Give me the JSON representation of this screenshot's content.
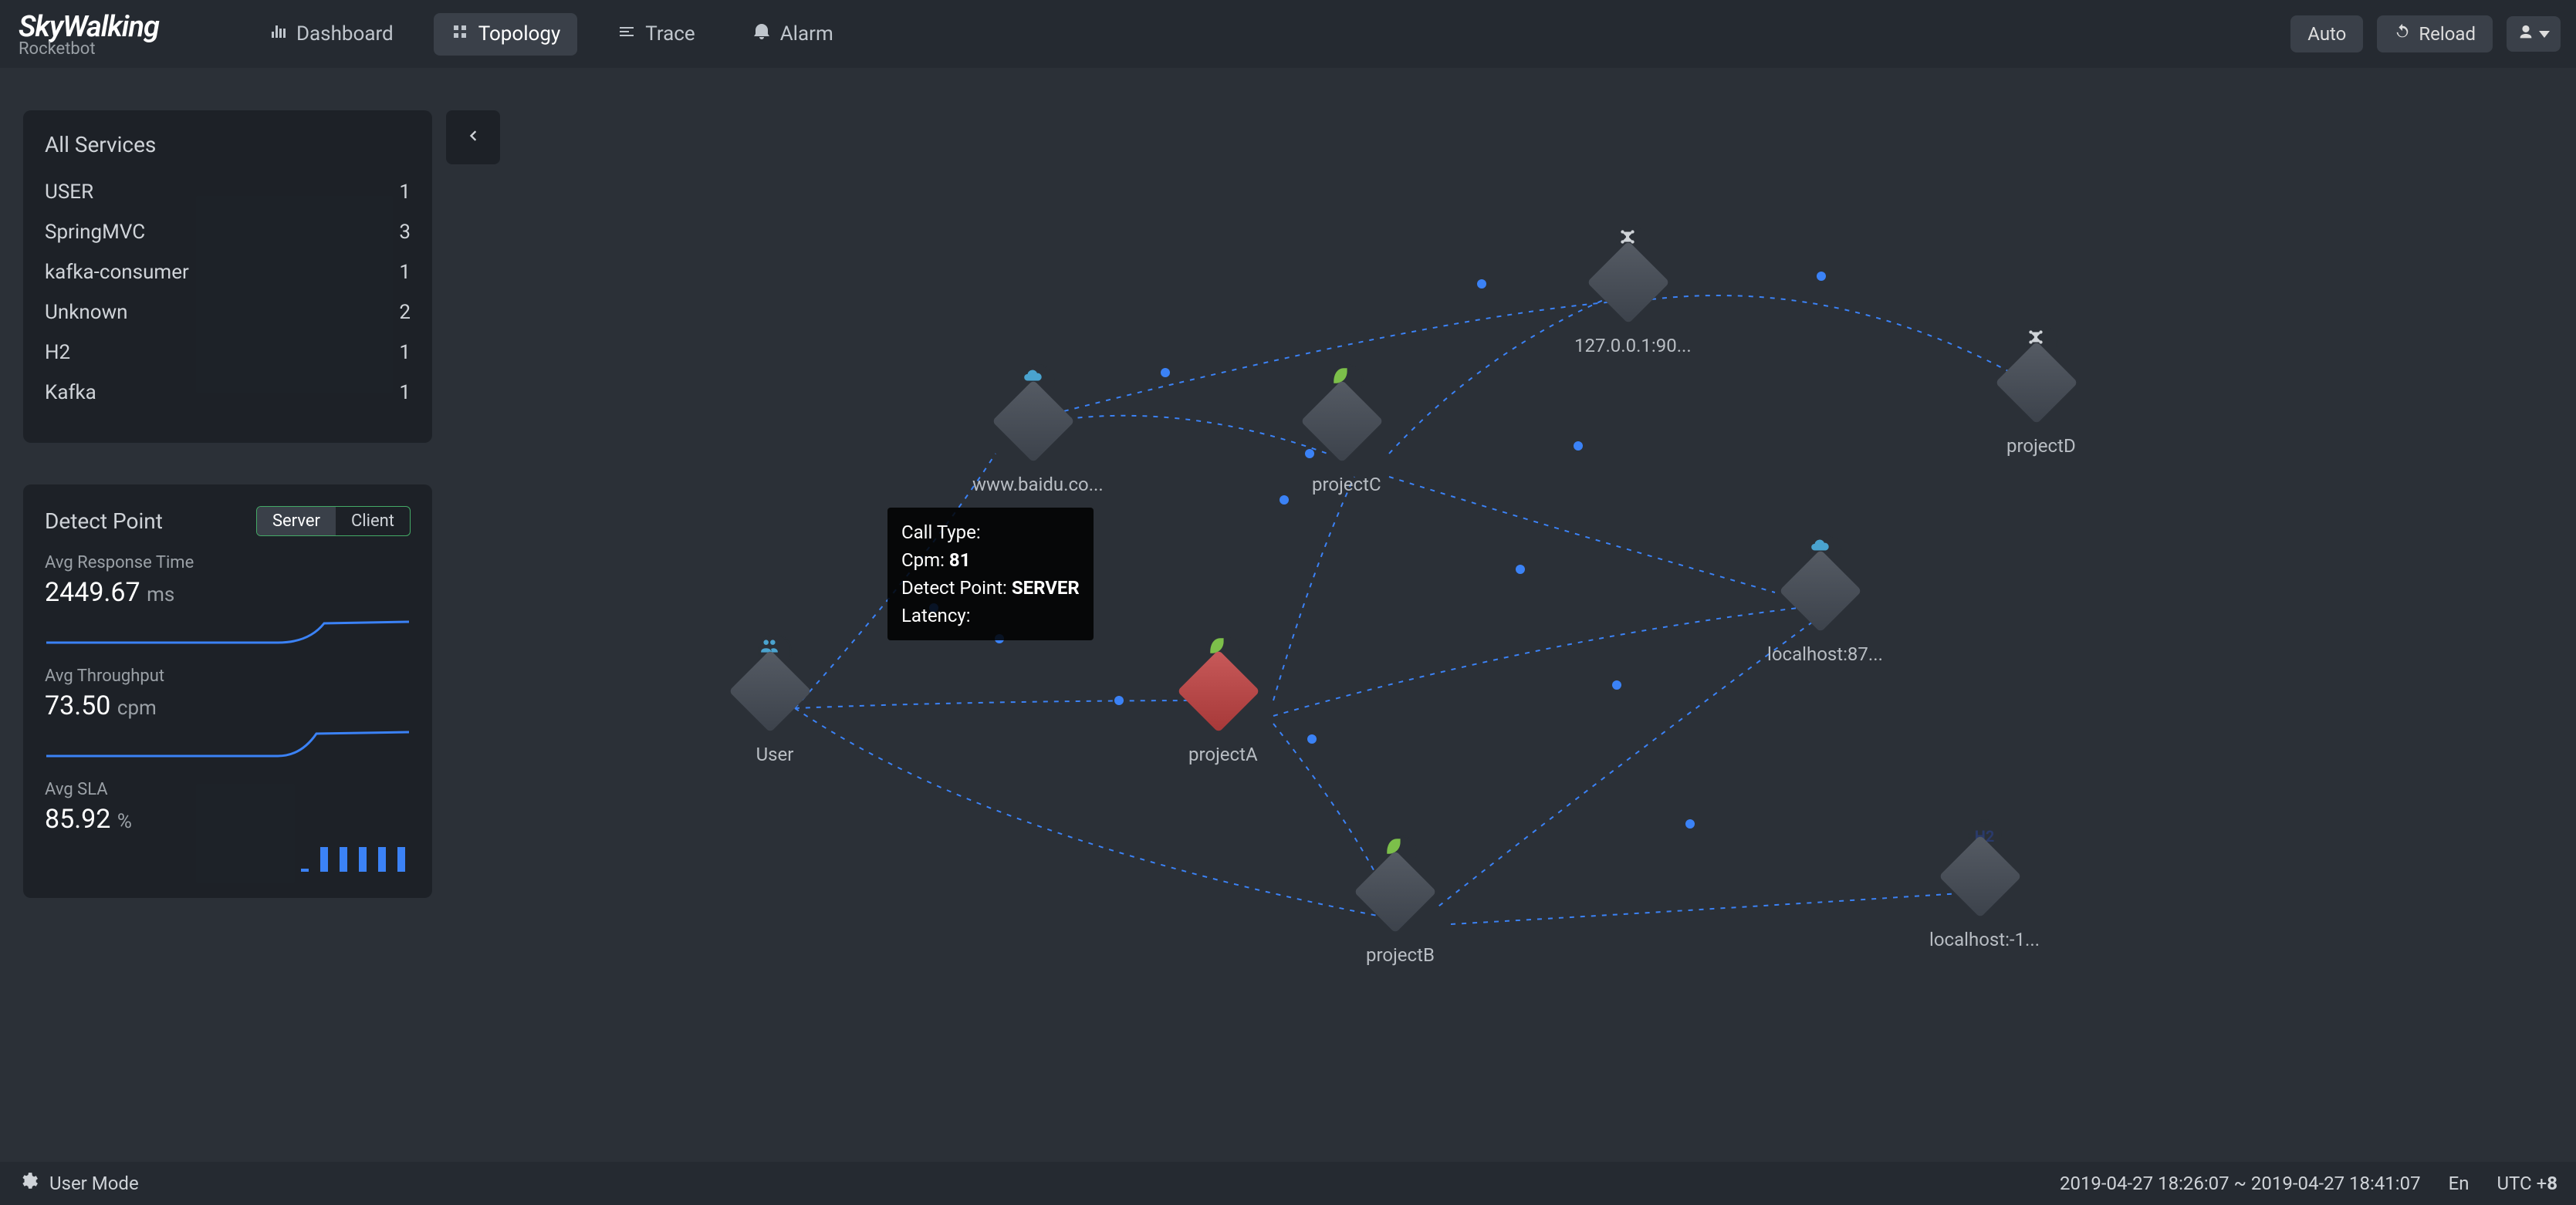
{
  "brand": {
    "name": "SkyWalking",
    "sub": "Rocketbot"
  },
  "nav": {
    "dashboard": "Dashboard",
    "topology": "Topology",
    "trace": "Trace",
    "alarm": "Alarm"
  },
  "topbar": {
    "auto": "Auto",
    "reload": "Reload"
  },
  "side": {
    "title": "All Services",
    "items": [
      {
        "name": "USER",
        "count": "1"
      },
      {
        "name": "SpringMVC",
        "count": "3"
      },
      {
        "name": "kafka-consumer",
        "count": "1"
      },
      {
        "name": "Unknown",
        "count": "2"
      },
      {
        "name": "H2",
        "count": "1"
      },
      {
        "name": "Kafka",
        "count": "1"
      }
    ]
  },
  "detect": {
    "title": "Detect Point",
    "server": "Server",
    "client": "Client",
    "rt_label": "Avg Response Time",
    "rt_value": "2449.67",
    "rt_unit": "ms",
    "tp_label": "Avg Throughput",
    "tp_value": "73.50",
    "tp_unit": "cpm",
    "sla_label": "Avg SLA",
    "sla_value": "85.92",
    "sla_unit": "%"
  },
  "tooltip": {
    "call_type_label": "Call Type:",
    "call_type": "",
    "cpm_label": "Cpm:",
    "cpm": "81",
    "dp_label": "Detect Point:",
    "dp": "SERVER",
    "lat_label": "Latency:",
    "lat": ""
  },
  "nodes": {
    "user": {
      "label": "User"
    },
    "baidu": {
      "label": "www.baidu.co..."
    },
    "projectA": {
      "label": "projectA"
    },
    "projectB": {
      "label": "projectB"
    },
    "projectC": {
      "label": "projectC"
    },
    "projectD": {
      "label": "projectD"
    },
    "n127": {
      "label": "127.0.0.1:90..."
    },
    "lh87": {
      "label": "localhost:87..."
    },
    "lhNeg1": {
      "label": "localhost:-1..."
    }
  },
  "bottom": {
    "user_mode": "User Mode",
    "range": "2019-04-27 18:26:07 ~ 2019-04-27 18:41:07",
    "lang": "En",
    "utc": "UTC +",
    "utc_n": "8"
  },
  "colors": {
    "accent": "#3b82f6",
    "leaf": "#7cbf4a",
    "cloud": "#4aa3cf",
    "h2": "#2a3a6a"
  }
}
